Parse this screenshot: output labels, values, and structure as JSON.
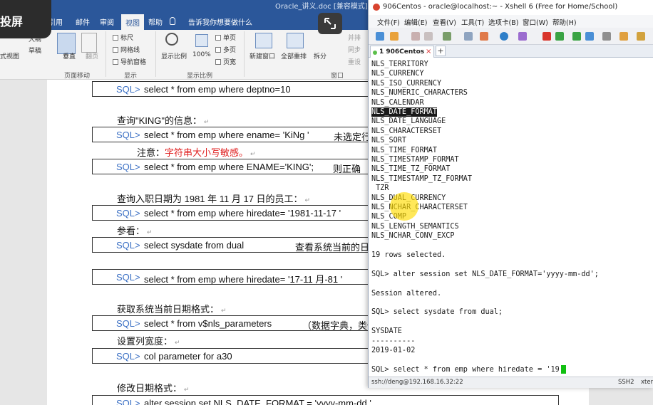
{
  "projection": {
    "label": "投屏"
  },
  "word": {
    "doc_title": "Oracle_讲义.doc [兼容模式] -",
    "tabs": [
      "引用",
      "邮件",
      "审阅",
      "视图",
      "帮助"
    ],
    "active_tab": "视图",
    "tell_me": "告诉我你想要做什么",
    "ribbon": {
      "left_partial": [
        "大纲",
        "草稿"
      ],
      "view_partial": "式视图",
      "vertical": "垂直",
      "page_flip": "翻页",
      "page_move_group": "页面移动",
      "checkboxes": [
        "标尺",
        "网格线",
        "导航窗格"
      ],
      "show_group": "显示",
      "zoom": "显示比例",
      "hundred": "100%",
      "single_page": "单页",
      "multi_page": "多页",
      "page_width": "页宽",
      "zoom_group": "显示比例",
      "new_window": "新建窗口",
      "arrange_all": "全部重排",
      "split": "拆分",
      "window_group": "窗口",
      "side_by_side": [
        "并排",
        "同步",
        "重设"
      ]
    },
    "doc_lines": {
      "l1_prompt": "SQL>",
      "l1_code": "select * from emp where deptno=10",
      "p1": "查询\"KING\"的信息：",
      "l2_prompt": "SQL>",
      "l2_code": "select * from emp where ename= 'KiNg '",
      "l2_note": "未选定行",
      "p2_prefix": "注意：",
      "p2_red": "字符串大小写敏感。",
      "l3_prompt": "SQL>",
      "l3_code": "select * from emp where ENAME='KING';",
      "l3_note": "则正确",
      "p3": "查询入职日期为 1981 年 11 月 17 日的员工：",
      "l4_prompt": "SQL>",
      "l4_code": "select * from emp where hiredate= '1981-11-17 '",
      "p4": "参看：",
      "l5_prompt": "SQL>",
      "l5_code": "select sysdate from dual",
      "l5_note": "查看系统当前的日",
      "l6_prompt": "SQL>",
      "l6_code": "select * from emp where hiredate= '17-11 月-81 '",
      "p5": "获取系统当前日期格式：",
      "l7_prompt": "SQL>",
      "l7_code": "select * from v$nls_parameters",
      "l7_note": "（数据字典，类似",
      "p6": "设置列宽度：",
      "l8_prompt": "SQL>",
      "l8_code": "col parameter for a30",
      "p7": "修改日期格式：",
      "l9_prompt": "SQL>",
      "l9_code": "alter session set NLS_DATE_FORMAT = 'yyyy-mm-dd '"
    }
  },
  "xshell": {
    "title": "906Centos - oracle@localhost:~ - Xshell 6 (Free for Home/School)",
    "menu": [
      "文件(F)",
      "编辑(E)",
      "查看(V)",
      "工具(T)",
      "选项卡(B)",
      "窗口(W)",
      "帮助(H)"
    ],
    "tab_label": "1 906Centos",
    "tab_close": "×",
    "tab_add": "+",
    "terminal_lines": [
      "NLS_TERRITORY",
      "NLS_CURRENCY",
      "NLS_ISO_CURRENCY",
      "NLS_NUMERIC_CHARACTERS",
      "NLS_CALENDAR",
      "NLS_DATE_FORMAT",
      "NLS_DATE_LANGUAGE",
      "NLS_CHARACTERSET",
      "NLS_SORT",
      "NLS_TIME_FORMAT",
      "NLS_TIMESTAMP_FORMAT",
      "NLS_TIME_TZ_FORMAT",
      "NLS_TIMESTAMP_TZ_FORMAT",
      " TZR",
      "NLS_DUAL_CURRENCY",
      "NLS_NCHAR_CHARACTERSET",
      "NLS_COMP",
      "NLS_LENGTH_SEMANTICS",
      "NLS_NCHAR_CONV_EXCP",
      "",
      "19 rows selected.",
      "",
      "SQL> alter session set NLS_DATE_FORMAT='yyyy-mm-dd';",
      "",
      "Session altered.",
      "",
      "SQL> select sysdate from dual;",
      "",
      "SYSDATE",
      "----------",
      "2019-01-02",
      "",
      "SQL> select * from emp where hiredate = '19"
    ],
    "highlighted_line": 5,
    "status": {
      "connection": "ssh://deng@192.168.16.32:22",
      "protocol": "SSH2",
      "term": "xterm"
    }
  }
}
